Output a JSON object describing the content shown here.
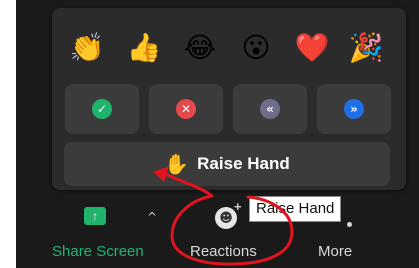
{
  "reactions_panel": {
    "emojis": [
      {
        "icon": "clapping-hands-icon",
        "glyph": "👏"
      },
      {
        "icon": "thumbs-up-icon",
        "glyph": "👍"
      },
      {
        "icon": "tears-of-joy-icon",
        "glyph": "😂"
      },
      {
        "icon": "surprised-face-icon",
        "glyph": "😮"
      },
      {
        "icon": "red-heart-icon",
        "glyph": "❤️"
      },
      {
        "icon": "party-popper-icon",
        "glyph": "🎉"
      }
    ],
    "feedback": [
      {
        "icon": "check-icon",
        "glyph": "✓",
        "color": "#1fb36b"
      },
      {
        "icon": "x-icon",
        "glyph": "✕",
        "color": "#e5484d"
      },
      {
        "icon": "rewind-icon",
        "glyph": "«",
        "color": "#6e6e8a"
      },
      {
        "icon": "fast-forward-icon",
        "glyph": "»",
        "color": "#1e6fe8"
      }
    ],
    "raise_hand": {
      "glyph": "✋",
      "label": "Raise Hand"
    }
  },
  "toolbar": {
    "share_screen": {
      "label": "Share Screen",
      "glyph": "↑",
      "color": "#22b573"
    },
    "caret": "^",
    "reactions": {
      "label": "Reactions",
      "glyph": "☻",
      "plus": "+"
    },
    "more": {
      "label": "More"
    }
  },
  "tooltip": {
    "text": "Raise Hand"
  },
  "annotation_color": "#e0141e"
}
